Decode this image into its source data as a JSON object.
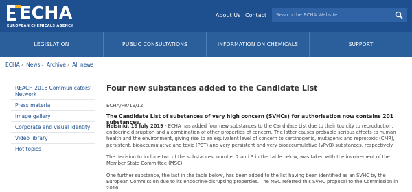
{
  "header": {
    "logo_text": "ECHA",
    "logo_sub": "EUROPEAN CHEMICALS AGENCY",
    "about_label": "About Us",
    "contact_label": "Contact",
    "search_placeholder": "Search the ECHA Website"
  },
  "nav": {
    "items": [
      {
        "label": "LEGISLATION"
      },
      {
        "label": "PUBLIC CONSULTATIONS"
      },
      {
        "label": "INFORMATION ON CHEMICALS"
      },
      {
        "label": "SUPPORT"
      }
    ]
  },
  "breadcrumb": [
    "ECHA",
    "News",
    "Archive",
    "All news"
  ],
  "sidebar": {
    "items": [
      {
        "label": "REACH 2018 Communicators' Network"
      },
      {
        "label": "Press material"
      },
      {
        "label": "Image gallery"
      },
      {
        "label": "Corporate and visual Identity"
      },
      {
        "label": "Video library"
      },
      {
        "label": "Hot topics"
      }
    ]
  },
  "article": {
    "title": "Four new substances added to the Candidate List",
    "press_release_id": "ECHA/PR/19/12",
    "lead": "The Candidate List of substances of very high concern (SVHCs) for authorisation now contains 201 substances.",
    "dateline": "Helsinki, 16 July 2019",
    "p1": " - ECHA has added four new substances to the Candidate List due to their toxicity to reproduction, endocrine disruption and a combination of other properties of concern. The latter causes probable serious effects to human health and the environment, giving rise to an equivalent level of concern to carcinogenic, mutagenic and reprotoxic (CMR), persistent, bioaccumulative and toxic (PBT) and very persistent and very bioaccumulative (vPvB) substances, respectively.",
    "p2": "The decision to include two of the substances, number 2 and 3 in the table below, was taken with the involvement of the Member State Committee (MSC).",
    "p3": "One further substance, the last in the table below, has been added to the list having been identified as an SVHC by the European Commission due to its endocrine-disrupting properties. The MSC referred this SVHC proposal to the Commission in 2016."
  },
  "colors": {
    "header_bg": "#1e4f8f",
    "nav_bg": "#2a5f9c",
    "link": "#1e4f8f"
  }
}
